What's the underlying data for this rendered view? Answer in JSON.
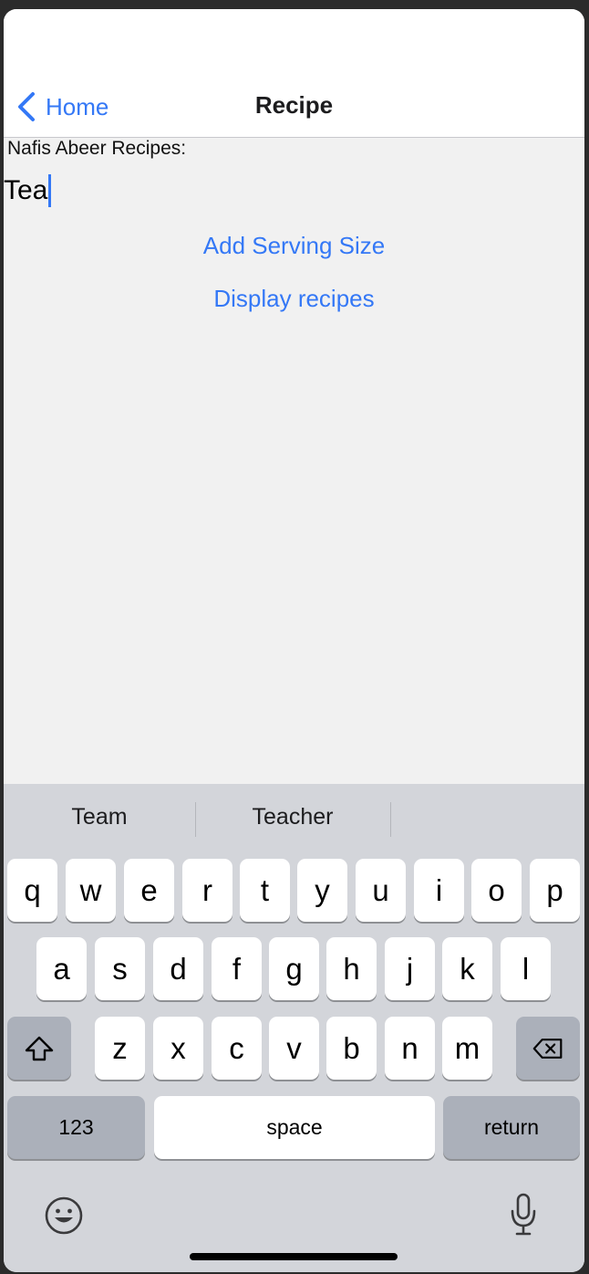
{
  "navbar": {
    "back_label": "Home",
    "title": "Recipe"
  },
  "content": {
    "section_label": "Nafis Abeer Recipes:",
    "input_value": "Tea",
    "add_serving_label": "Add Serving Size",
    "display_recipes_label": "Display recipes"
  },
  "keyboard": {
    "suggestions": [
      "Team",
      "Teacher",
      ""
    ],
    "row1": [
      "q",
      "w",
      "e",
      "r",
      "t",
      "y",
      "u",
      "i",
      "o",
      "p"
    ],
    "row2": [
      "a",
      "s",
      "d",
      "f",
      "g",
      "h",
      "j",
      "k",
      "l"
    ],
    "row3": [
      "z",
      "x",
      "c",
      "v",
      "b",
      "n",
      "m"
    ],
    "numbers_label": "123",
    "space_label": "space",
    "return_label": "return",
    "icons": {
      "shift": "shift-icon",
      "delete": "delete-icon",
      "emoji": "emoji-icon",
      "dictation": "microphone-icon"
    }
  },
  "colors": {
    "accent": "#3478f6",
    "keyboard_bg": "#d3d5da",
    "content_bg": "#f1f1f1"
  }
}
